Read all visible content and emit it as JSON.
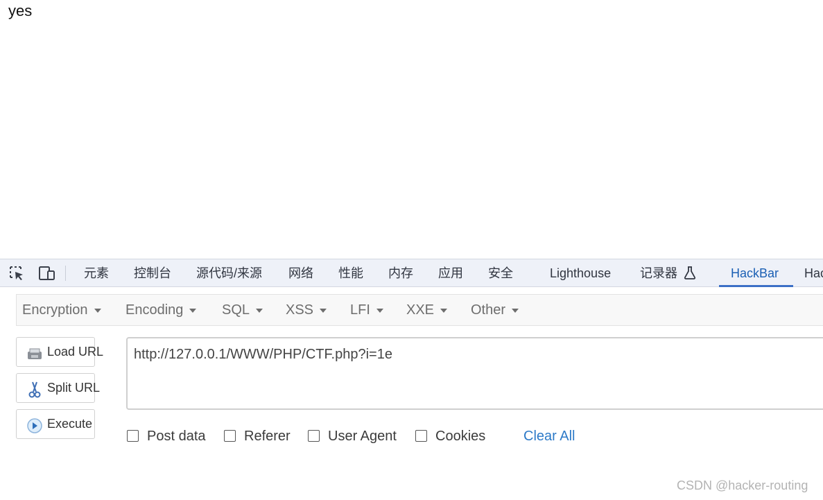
{
  "page": {
    "body_text": "yes"
  },
  "devtools": {
    "tabs": [
      {
        "label": "元素"
      },
      {
        "label": "控制台"
      },
      {
        "label": "源代码/来源"
      },
      {
        "label": "网络"
      },
      {
        "label": "性能"
      },
      {
        "label": "内存"
      },
      {
        "label": "应用"
      },
      {
        "label": "安全"
      },
      {
        "label": "Lighthouse"
      },
      {
        "label": "记录器"
      },
      {
        "label": "HackBar"
      },
      {
        "label": "Hac"
      }
    ],
    "active_tab": "HackBar",
    "icons": [
      "inspect-element-icon",
      "device-toolbar-icon",
      "flask-icon"
    ]
  },
  "hackbar": {
    "menu": [
      {
        "label": "Encryption"
      },
      {
        "label": "Encoding"
      },
      {
        "label": "SQL"
      },
      {
        "label": "XSS"
      },
      {
        "label": "LFI"
      },
      {
        "label": "XXE"
      },
      {
        "label": "Other"
      }
    ],
    "buttons": [
      {
        "label": "Load URL",
        "icon": "load-url-icon"
      },
      {
        "label": "Split URL",
        "icon": "scissors-icon"
      },
      {
        "label": "Execute",
        "icon": "play-icon"
      }
    ],
    "url_value": "http://127.0.0.1/WWW/PHP/CTF.php?i=1e",
    "options": [
      {
        "label": "Post data",
        "checked": false
      },
      {
        "label": "Referer",
        "checked": false
      },
      {
        "label": "User Agent",
        "checked": false
      },
      {
        "label": "Cookies",
        "checked": false
      }
    ],
    "clear_all": "Clear All"
  },
  "watermark": "CSDN @hacker-routing",
  "colors": {
    "tabbar_bg": "#eef1f8",
    "active_tab": "#1a5fb4",
    "clear_all_link": "#2d7ac8"
  }
}
